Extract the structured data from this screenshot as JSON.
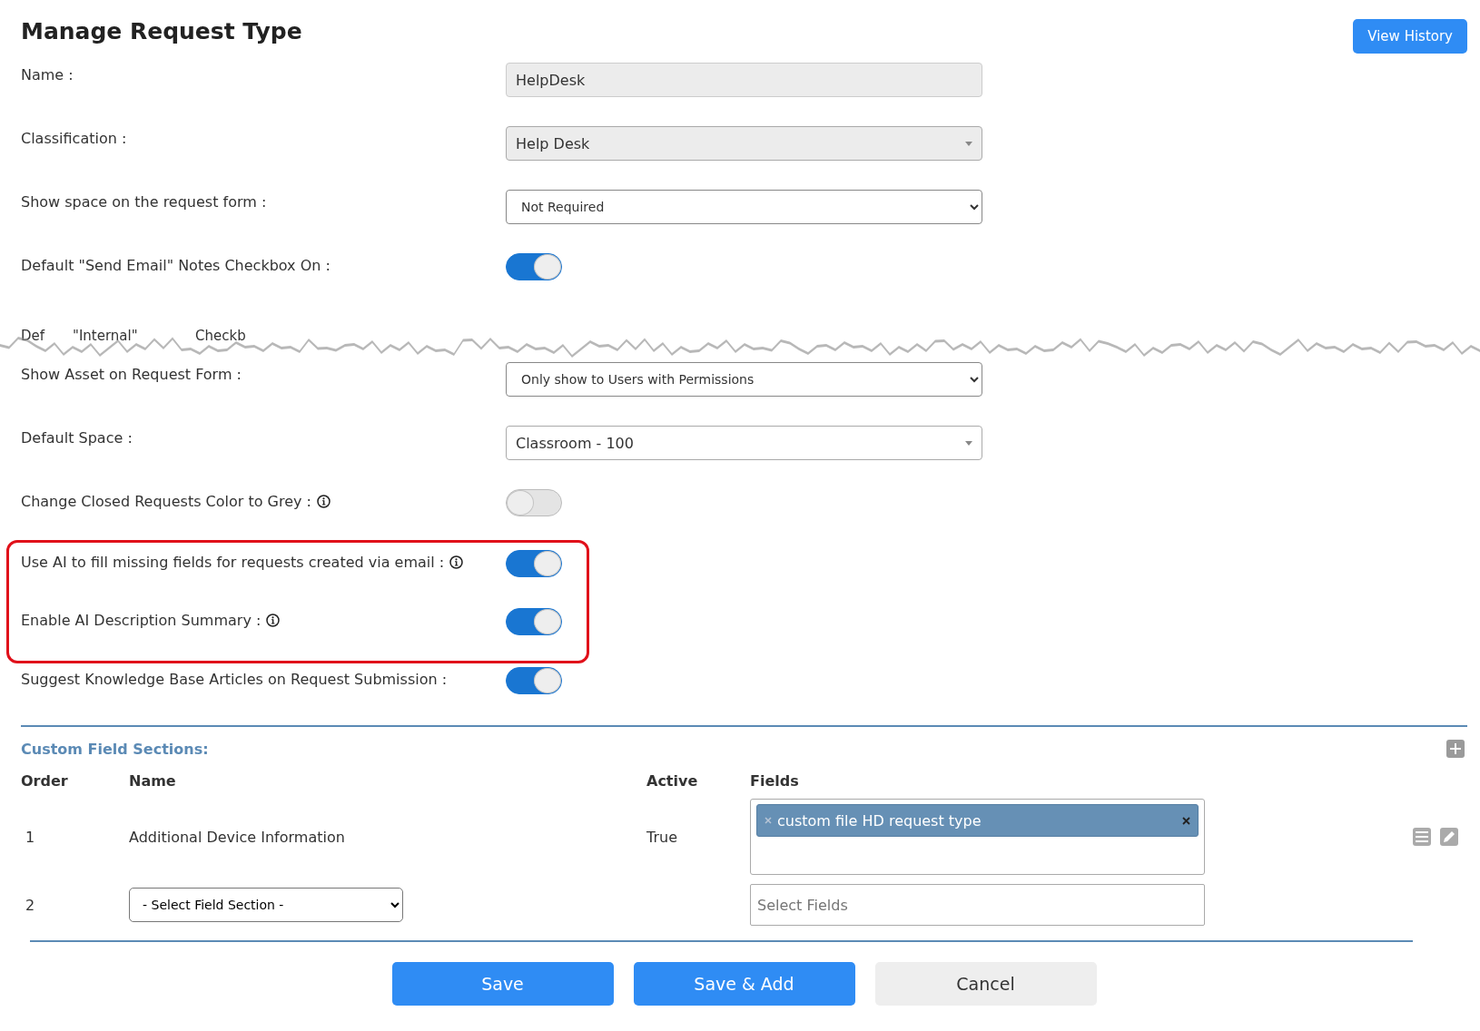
{
  "header": {
    "title": "Manage Request Type",
    "history_button": "View History"
  },
  "settings": [
    {
      "kind": "text",
      "label": "Name :",
      "value": "HelpDesk",
      "disabled": true
    },
    {
      "kind": "combo",
      "label": "Classification :",
      "value": "Help Desk",
      "disabled": true
    },
    {
      "kind": "select",
      "label": "Show space on the request form :",
      "value": "Not Required"
    },
    {
      "kind": "toggle",
      "label": "Default \"Send Email\" Notes Checkbox On :",
      "on": true,
      "info": false,
      "highlighted": false
    },
    {
      "kind": "torn",
      "fragments": [
        "Def",
        "\"Internal\"",
        "Checkb"
      ]
    },
    {
      "kind": "select",
      "label": "Show Asset on Request Form :",
      "value": "Only show to Users with Permissions"
    },
    {
      "kind": "combo",
      "label": "Default Space :",
      "value": "Classroom - 100",
      "disabled": false
    },
    {
      "kind": "toggle",
      "label": "Change Closed Requests Color to Grey :",
      "on": false,
      "info": true,
      "highlighted": false
    },
    {
      "kind": "toggle",
      "label": "Use AI to fill missing fields for requests created via email :",
      "on": true,
      "info": true,
      "highlighted": true
    },
    {
      "kind": "toggle",
      "label": "Enable AI Description Summary :",
      "on": true,
      "info": true,
      "highlighted": true
    },
    {
      "kind": "toggle",
      "label": "Suggest Knowledge Base Articles on Request Submission :",
      "on": true,
      "info": false,
      "highlighted": false
    }
  ],
  "custom_fields": {
    "title": "Custom Field Sections:",
    "columns": [
      "Order",
      "Name",
      "Active",
      "Fields"
    ],
    "rows": [
      {
        "kind": "section",
        "order": "1",
        "name": "Additional Device Information",
        "active": "True",
        "tags": [
          "custom file HD request type"
        ]
      },
      {
        "kind": "new",
        "order": "2",
        "section": "- Select Field Section -",
        "fields_placeholder": "Select Fields"
      }
    ]
  },
  "actions": [
    {
      "label": "Save",
      "kind": "primary"
    },
    {
      "label": "Save & Add",
      "kind": "primary"
    },
    {
      "label": "Cancel",
      "kind": "secondary"
    }
  ]
}
